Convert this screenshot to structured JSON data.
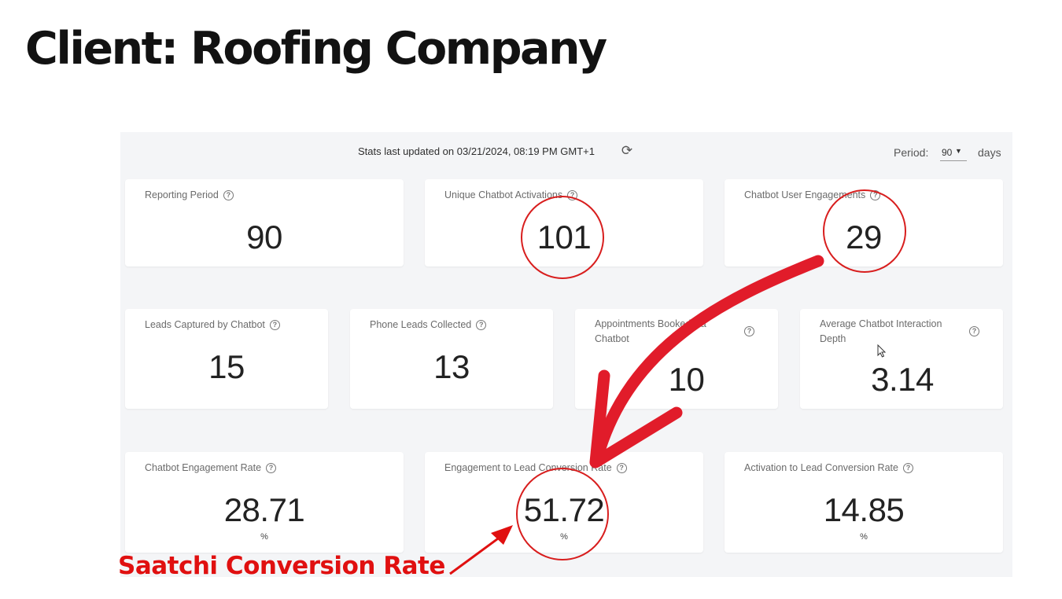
{
  "title": "Client: Roofing Company",
  "header": {
    "updated_text": "Stats last updated on 03/21/2024, 08:19 PM GMT+1",
    "period_label": "Period:",
    "period_value": "90",
    "days_label": "days"
  },
  "cards": {
    "reporting_period": {
      "label": "Reporting Period",
      "value": "90"
    },
    "unique_activations": {
      "label": "Unique Chatbot Activations",
      "value": "101"
    },
    "user_engagements": {
      "label": "Chatbot User Engagements",
      "value": "29"
    },
    "leads_captured": {
      "label": "Leads Captured by Chatbot",
      "value": "15"
    },
    "phone_leads": {
      "label": "Phone Leads Collected",
      "value": "13"
    },
    "appointments": {
      "label": "Appointments Booked via Chatbot",
      "value": "10"
    },
    "avg_depth": {
      "label": "Average Chatbot Interaction Depth",
      "value": "3.14"
    },
    "engagement_rate": {
      "label": "Chatbot Engagement Rate",
      "value": "28.71",
      "unit": "%"
    },
    "engagement_to_lead": {
      "label": "Engagement to Lead Conversion Rate",
      "value": "51.72",
      "unit": "%"
    },
    "activation_to_lead": {
      "label": "Activation to Lead Conversion Rate",
      "value": "14.85",
      "unit": "%"
    }
  },
  "help_glyph": "?",
  "icons": {
    "refresh": "refresh-icon",
    "help": "help-circle-icon",
    "cursor": "mouse-cursor-icon"
  },
  "annotation": {
    "label": "Saatchi Conversion Rate",
    "color": "#e01010"
  }
}
